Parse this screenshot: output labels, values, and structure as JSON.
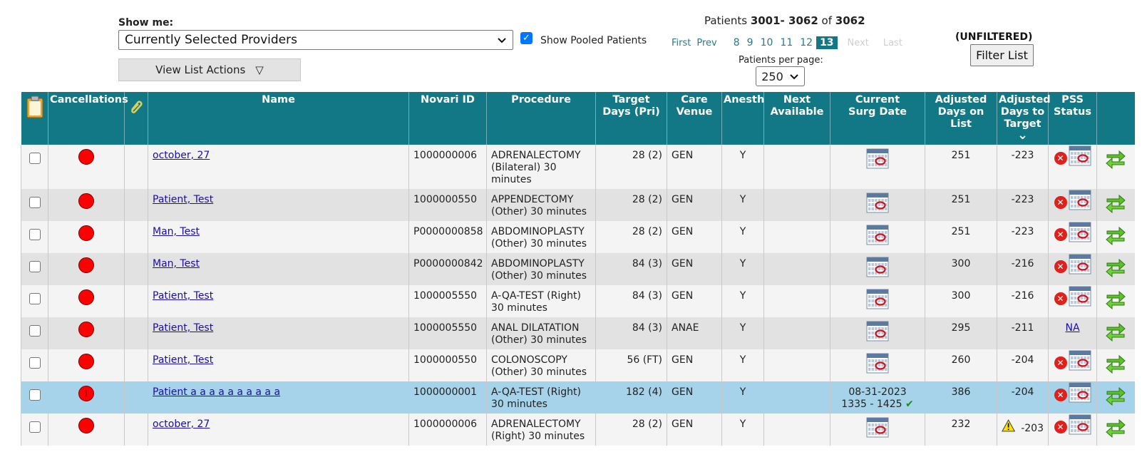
{
  "toolbar": {
    "show_me_label": "Show me:",
    "provider_select_value": "Currently Selected Providers",
    "show_pooled_label": "Show Pooled Patients",
    "view_list_actions_label": "View List Actions",
    "view_list_actions_arrow": "▽",
    "filter_status": "(UNFILTERED)",
    "filter_button_label": "Filter List"
  },
  "pagination": {
    "summary_prefix": "Patients ",
    "range": "3001- 3062",
    "of": " of ",
    "total": "3062",
    "first": "First",
    "prev": "Prev",
    "pages": [
      "8",
      "9",
      "10",
      "11",
      "12"
    ],
    "current_page": "13",
    "next": "Next",
    "last": "Last",
    "per_page_label": "Patients per page:",
    "per_page_value": "250"
  },
  "colors": {
    "header_bg": "#137886",
    "row_odd": "#f4f4f4",
    "row_even": "#e2e2e2",
    "row_selected": "#a6d3e9",
    "cancel_dot": "#ff0000"
  },
  "icons": {
    "clipboard": "clipboard-icon",
    "attachment": "paperclip-icon",
    "calendar": "calendar-icon",
    "remove": "red-x-icon",
    "transfer": "green-arrows-icon",
    "warning": "warning-icon"
  },
  "columns": {
    "cancellations": "Cancellations",
    "name": "Name",
    "novari_id": "Novari ID",
    "procedure": "Procedure",
    "target_days_1": "Target",
    "target_days_2": "Days (Pri)",
    "care_venue_1": "Care",
    "care_venue_2": "Venue",
    "anesth": "Anesth",
    "next_available_1": "Next",
    "next_available_2": "Available",
    "current_surg_1": "Current",
    "current_surg_2": "Surg Date",
    "adj_days_list_1": "Adjusted",
    "adj_days_list_2": "Days on List",
    "adj_days_target_1": "Adjusted",
    "adj_days_target_2": "Days to",
    "adj_days_target_3": "Target",
    "sort_indicator": "⌄",
    "pss_1": "PSS",
    "pss_2": "Status"
  },
  "rows": [
    {
      "cancel_badge": "",
      "name": "october, 27",
      "novari_id": "1000000006",
      "procedure": "ADRENALECTOMY (Bilateral) 30 minutes",
      "target": "28 (2)",
      "venue": "GEN",
      "anesth": "Y",
      "next_available": "",
      "surg_date": "",
      "surg_time": "",
      "adj_days_list": "251",
      "adj_days_target": "-223",
      "pss": "",
      "warning": false
    },
    {
      "cancel_badge": "",
      "name": "Patient, Test",
      "novari_id": "1000000550",
      "procedure": "APPENDECTOMY (Other) 30 minutes",
      "target": "28 (2)",
      "venue": "GEN",
      "anesth": "Y",
      "next_available": "",
      "surg_date": "",
      "surg_time": "",
      "adj_days_list": "251",
      "adj_days_target": "-223",
      "pss": "",
      "warning": false
    },
    {
      "cancel_badge": "",
      "name": "Man, Test",
      "novari_id": "P0000000858",
      "procedure": "ABDOMINOPLASTY (Other) 30 minutes",
      "target": "28 (2)",
      "venue": "GEN",
      "anesth": "Y",
      "next_available": "",
      "surg_date": "",
      "surg_time": "",
      "adj_days_list": "251",
      "adj_days_target": "-223",
      "pss": "",
      "warning": false
    },
    {
      "cancel_badge": "",
      "name": "Man, Test",
      "novari_id": "P0000000842",
      "procedure": "ABDOMINOPLASTY (Other) 30 minutes",
      "target": "84 (3)",
      "venue": "GEN",
      "anesth": "Y",
      "next_available": "",
      "surg_date": "",
      "surg_time": "",
      "adj_days_list": "300",
      "adj_days_target": "-216",
      "pss": "",
      "warning": false
    },
    {
      "cancel_badge": "",
      "name": "Patient, Test",
      "novari_id": "1000005550",
      "procedure": "A-QA-TEST (Right) 30 minutes",
      "target": "84 (3)",
      "venue": "GEN",
      "anesth": "Y",
      "next_available": "",
      "surg_date": "",
      "surg_time": "",
      "adj_days_list": "300",
      "adj_days_target": "-216",
      "pss": "",
      "warning": false
    },
    {
      "cancel_badge": "",
      "name": "Patient, Test",
      "novari_id": "1000005550",
      "procedure": "ANAL DILATATION (Other) 30 minutes",
      "target": "84 (3)",
      "venue": "ANAE",
      "anesth": "Y",
      "next_available": "",
      "surg_date": "",
      "surg_time": "",
      "adj_days_list": "295",
      "adj_days_target": "-211",
      "pss": "NA",
      "warning": false
    },
    {
      "cancel_badge": "",
      "name": "Patient, Test",
      "novari_id": "1000000550",
      "procedure": "COLONOSCOPY (Other) 30 minutes",
      "target": "56 (FT)",
      "venue": "GEN",
      "anesth": "Y",
      "next_available": "",
      "surg_date": "",
      "surg_time": "",
      "adj_days_list": "260",
      "adj_days_target": "-204",
      "pss": "",
      "warning": false
    },
    {
      "cancel_badge": "1",
      "name": "Patient a a a a a a a a a a",
      "novari_id": "1000000001",
      "procedure": "A-QA-TEST (Right) 30 minutes",
      "target": "182 (4)",
      "venue": "GEN",
      "anesth": "Y",
      "next_available": "",
      "surg_date": "08-31-2023",
      "surg_time": "1335 - 1425",
      "surg_check": "✔",
      "adj_days_list": "386",
      "adj_days_target": "-204",
      "pss": "",
      "warning": false
    },
    {
      "cancel_badge": "",
      "name": "october, 27",
      "novari_id": "1000000006",
      "procedure": "ADRENALECTOMY (Right) 30 minutes",
      "target": "28 (2)",
      "venue": "GEN",
      "anesth": "Y",
      "next_available": "",
      "surg_date": "",
      "surg_time": "",
      "adj_days_list": "232",
      "adj_days_target": "-203",
      "pss": "",
      "warning": true
    }
  ]
}
